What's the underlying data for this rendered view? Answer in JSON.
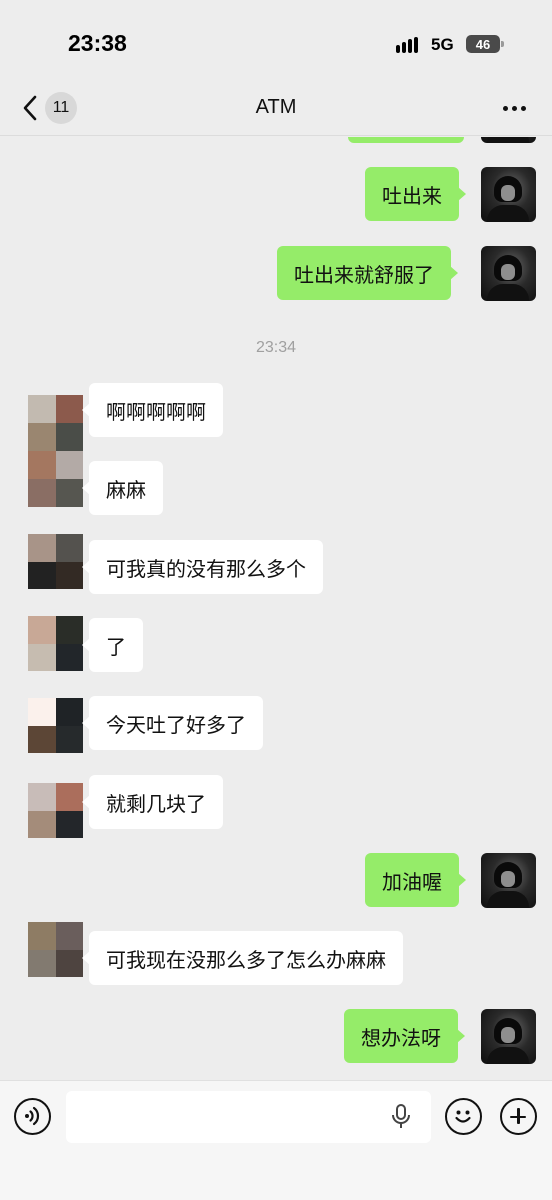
{
  "status_bar": {
    "time": "23:38",
    "network": "5G",
    "battery": "46"
  },
  "nav": {
    "back_count": "11",
    "title": "ATM"
  },
  "timestamp": "23:34",
  "messages": [
    {
      "side": "out",
      "text": ""
    },
    {
      "side": "out",
      "text": "吐出来"
    },
    {
      "side": "out",
      "text": "吐出来就舒服了"
    },
    {
      "side": "in",
      "text": "啊啊啊啊啊"
    },
    {
      "side": "in",
      "text": "麻麻"
    },
    {
      "side": "in",
      "text": "可我真的没有那么多个"
    },
    {
      "side": "in",
      "text": "了"
    },
    {
      "side": "in",
      "text": "今天吐了好多了"
    },
    {
      "side": "in",
      "text": "就剩几块了"
    },
    {
      "side": "out",
      "text": "加油喔"
    },
    {
      "side": "in",
      "text": "可我现在没那么多了怎么办麻麻"
    },
    {
      "side": "out",
      "text": "想办法呀"
    }
  ],
  "colors": {
    "bubble_out": "#95ec69",
    "bubble_in": "#ffffff",
    "background": "#ededed"
  },
  "icons": {
    "back": "chevron-left-icon",
    "more": "more-dots-icon",
    "voice": "voice-icon",
    "mic": "mic-icon",
    "emoji": "emoji-icon",
    "plus": "plus-icon"
  }
}
